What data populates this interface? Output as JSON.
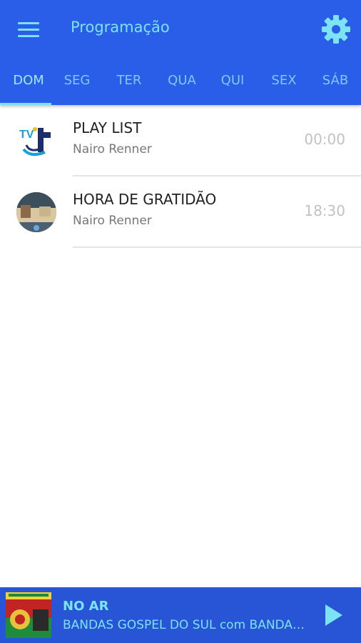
{
  "header": {
    "title": "Programação",
    "menu_icon": "hamburger-menu-icon",
    "settings_icon": "gear-icon"
  },
  "tabs": [
    {
      "label": "DOM",
      "active": true
    },
    {
      "label": "SEG",
      "active": false
    },
    {
      "label": "TER",
      "active": false
    },
    {
      "label": "QUA",
      "active": false
    },
    {
      "label": "QUI",
      "active": false
    },
    {
      "label": "SEX",
      "active": false
    },
    {
      "label": "SÁB",
      "active": false
    }
  ],
  "schedule": [
    {
      "title": "PLAY LIST",
      "host": "Nairo Renner",
      "time": "00:00",
      "thumb": "tv-logo-thumb"
    },
    {
      "title": "HORA DE GRATIDÃO",
      "host": "Nairo Renner",
      "time": "18:30",
      "thumb": "program-photo-thumb"
    }
  ],
  "player": {
    "status": "NO AR",
    "now_playing": "BANDAS GOSPEL DO SUL com BANDAS GOSPEL DO SUL",
    "play_icon": "play-icon"
  },
  "colors": {
    "appbar": "#2a5ee8",
    "accent": "#7ce3f5",
    "player_bar": "#2755d6"
  }
}
